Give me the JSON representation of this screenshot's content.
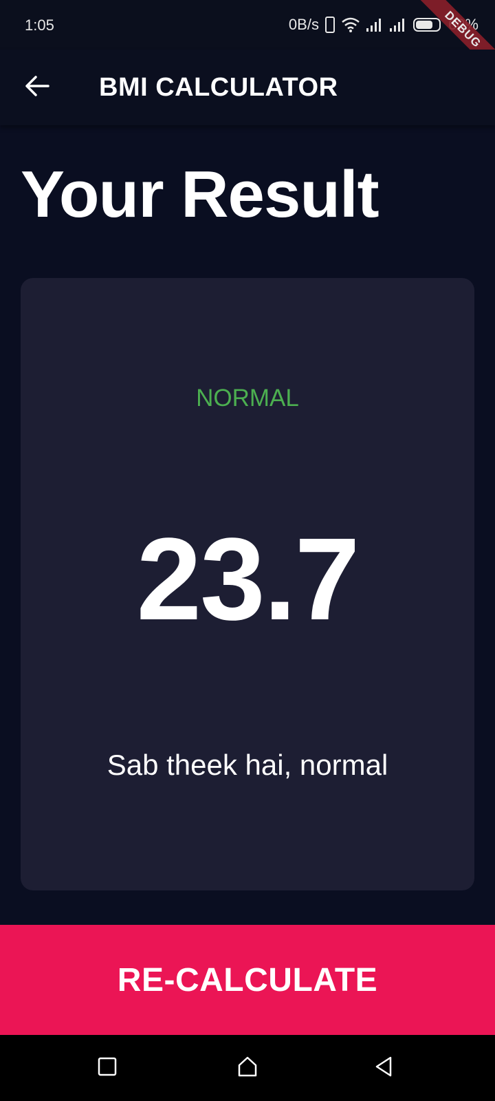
{
  "status_bar": {
    "time": "1:05",
    "network_speed": "0B/s",
    "battery_percent": "60%",
    "icons": [
      "phone-icon",
      "wifi-icon",
      "signal-icon",
      "signal-icon",
      "battery-icon"
    ]
  },
  "debug_banner": {
    "label": "DEBUG"
  },
  "app_bar": {
    "title": "BMI CALCULATOR",
    "back_icon": "arrow-left-icon"
  },
  "page": {
    "heading": "Your Result"
  },
  "result": {
    "category": "NORMAL",
    "bmi": "23.7",
    "message": "Sab theek hai, normal"
  },
  "actions": {
    "recalculate_label": "RE-CALCULATE"
  },
  "nav_bar": {
    "icons": [
      "square-recents-icon",
      "home-icon",
      "triangle-back-icon"
    ]
  },
  "colors": {
    "background": "#0A0E21",
    "card": "#1D1E33",
    "accent": "#EB1555",
    "normal": "#4CAF50"
  }
}
